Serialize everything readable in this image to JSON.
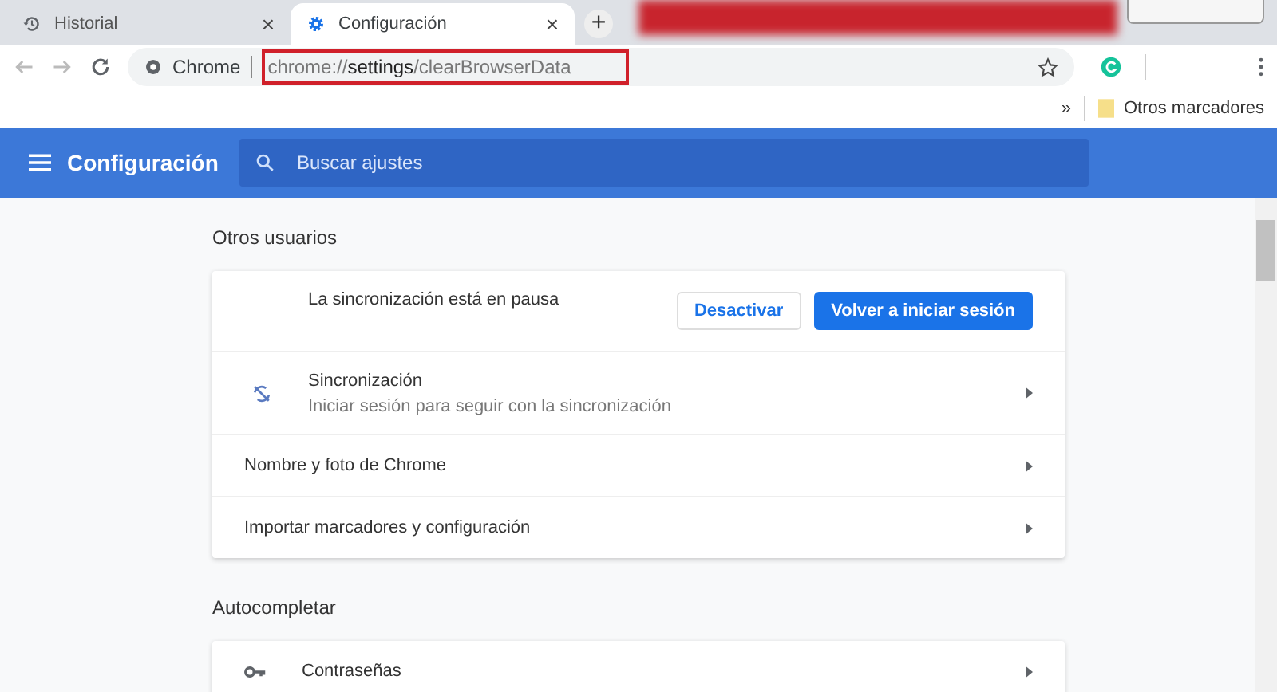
{
  "tabs": [
    {
      "label": "Historial",
      "kind": "history",
      "selected": false,
      "close": "×"
    },
    {
      "label": "Configuración",
      "kind": "gear",
      "selected": true,
      "close": "×"
    }
  ],
  "new_tab": "+",
  "address_bar": {
    "site": "Chrome",
    "url": "chrome://**settings**/clearBrowserData",
    "highlighted": true
  },
  "bookmarks_bar": {
    "overflow": "»",
    "folder": "Otros marcadores"
  },
  "header": {
    "title": "Configuración",
    "search_placeholder": "Buscar ajustes"
  },
  "sections": [
    {
      "title": "Otros usuarios",
      "rows": [
        {
          "kind": "account",
          "text": "La sincronización está en pausa",
          "buttons": [
            {
              "label": "Desactivar",
              "primary": false
            },
            {
              "label": "Volver a iniciar sesión",
              "primary": true
            }
          ]
        },
        {
          "kind": "sync",
          "title": "Sincronización",
          "subtitle": "Iniciar sesión para seguir con la sincronización"
        },
        {
          "kind": "link",
          "title": "Nombre y foto de Chrome"
        },
        {
          "kind": "link",
          "title": "Importar marcadores y configuración"
        }
      ]
    },
    {
      "title": "Autocompletar",
      "rows": [
        {
          "kind": "key",
          "title": "Contraseñas"
        }
      ]
    }
  ]
}
